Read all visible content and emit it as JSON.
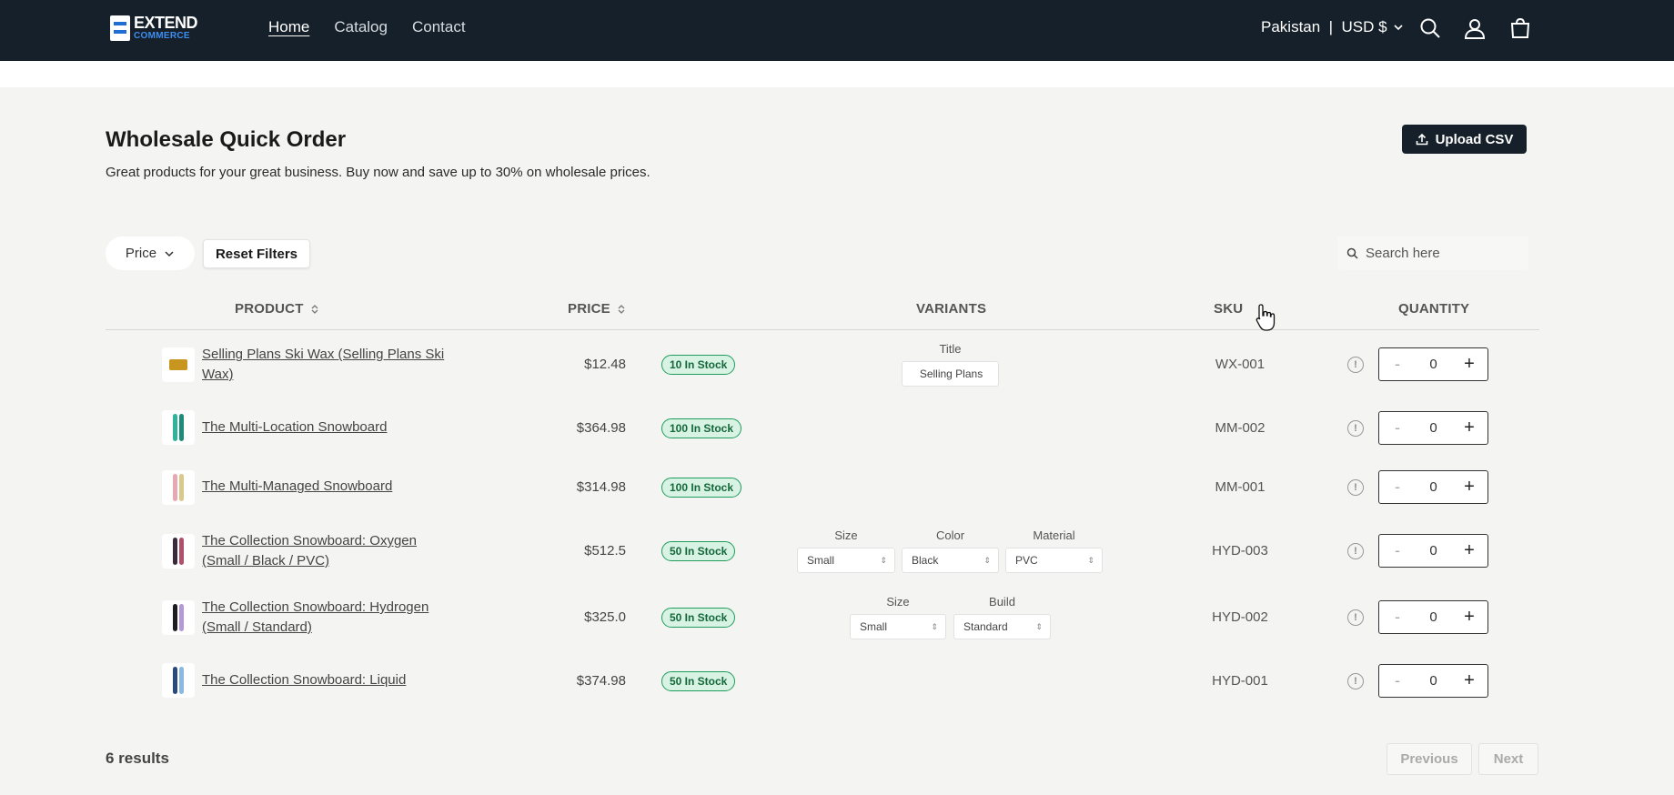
{
  "brand": {
    "line1": "EXTEND",
    "line2": "COMMERCE"
  },
  "nav": {
    "home": "Home",
    "catalog": "Catalog",
    "contact": "Contact"
  },
  "locale": "Pakistan  |  USD $",
  "page": {
    "title": "Wholesale Quick Order",
    "subtitle": "Great products for your great business. Buy now and save up to 30% on wholesale prices.",
    "upload_label": "Upload CSV"
  },
  "filters": {
    "price_label": "Price",
    "reset_label": "Reset Filters",
    "search_placeholder": "Search here"
  },
  "columns": {
    "product": "PRODUCT",
    "price": "PRICE",
    "variants": "VARIANTS",
    "sku": "SKU",
    "quantity": "QUANTITY"
  },
  "rows": [
    {
      "name": "Selling Plans Ski Wax (Selling Plans Ski Wax)",
      "price": "$12.48",
      "stock": "10 In Stock",
      "sku": "WX-001",
      "qty": "0",
      "variants": [
        {
          "label": "Title",
          "value": "Selling Plans"
        }
      ]
    },
    {
      "name": "The Multi-Location Snowboard",
      "price": "$364.98",
      "stock": "100 In Stock",
      "sku": "MM-002",
      "qty": "0",
      "variants": []
    },
    {
      "name": "The Multi-Managed Snowboard",
      "price": "$314.98",
      "stock": "100 In Stock",
      "sku": "MM-001",
      "qty": "0",
      "variants": []
    },
    {
      "name": "The Collection Snowboard: Oxygen (Small / Black / PVC)",
      "price": "$512.5",
      "stock": "50 In Stock",
      "sku": "HYD-003",
      "qty": "0",
      "variants": [
        {
          "label": "Size",
          "value": "Small"
        },
        {
          "label": "Color",
          "value": "Black"
        },
        {
          "label": "Material",
          "value": "PVC"
        }
      ]
    },
    {
      "name": "The Collection Snowboard: Hydrogen (Small / Standard)",
      "price": "$325.0",
      "stock": "50 In Stock",
      "sku": "HYD-002",
      "qty": "0",
      "variants": [
        {
          "label": "Size",
          "value": "Small"
        },
        {
          "label": "Build",
          "value": "Standard"
        }
      ]
    },
    {
      "name": "The Collection Snowboard: Liquid",
      "price": "$374.98",
      "stock": "50 In Stock",
      "sku": "HYD-001",
      "qty": "0",
      "variants": []
    }
  ],
  "footer": {
    "results": "6 results",
    "previous": "Previous",
    "next": "Next"
  },
  "qty_controls": {
    "minus": "-",
    "plus": "+"
  },
  "colors": {
    "header_bg": "#16202a",
    "accent": "#1e6fd1",
    "stock_border": "#1e9c5b",
    "stock_bg": "#d8f2e3"
  },
  "icons": [
    "search-icon",
    "account-icon",
    "cart-icon",
    "upload-icon",
    "chevron-down-icon",
    "sort-icon",
    "info-icon",
    "hand-cursor-icon"
  ]
}
